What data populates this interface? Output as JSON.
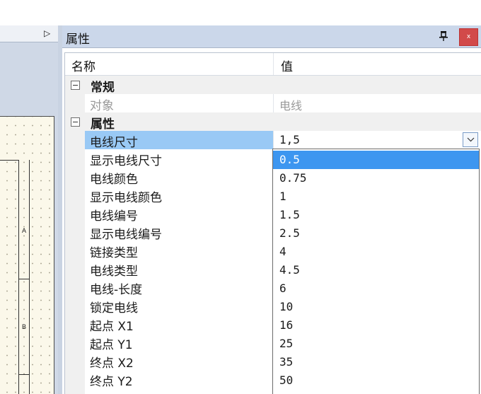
{
  "left_panel": {
    "collapse_arrow": "▷",
    "canvas_labels": [
      "A",
      "B"
    ]
  },
  "properties": {
    "title": "属性",
    "pin_icon": "pin-icon",
    "close_label": "x",
    "columns": {
      "name": "名称",
      "value": "值"
    },
    "rows": [
      {
        "kind": "category",
        "name": "常规"
      },
      {
        "kind": "property",
        "name": "对象",
        "value": "电线",
        "disabled": true
      },
      {
        "kind": "category",
        "name": "属性"
      },
      {
        "kind": "property",
        "name": "电线尺寸",
        "value": "1,5",
        "selected": true
      },
      {
        "kind": "property",
        "name": "显示电线尺寸"
      },
      {
        "kind": "property",
        "name": "电线颜色"
      },
      {
        "kind": "property",
        "name": "显示电线颜色"
      },
      {
        "kind": "property",
        "name": "电线编号"
      },
      {
        "kind": "property",
        "name": "显示电线编号"
      },
      {
        "kind": "property",
        "name": "链接类型"
      },
      {
        "kind": "property",
        "name": "电线类型"
      },
      {
        "kind": "property",
        "name": "电线-长度"
      },
      {
        "kind": "property",
        "name": "锁定电线"
      },
      {
        "kind": "property",
        "name": "起点 X1"
      },
      {
        "kind": "property",
        "name": "起点 Y1"
      },
      {
        "kind": "property",
        "name": "终点 X2"
      },
      {
        "kind": "property",
        "name": "终点 Y2"
      }
    ]
  },
  "dropdown": {
    "options": [
      "0.5",
      "0.75",
      "1",
      "1.5",
      "2.5",
      "4",
      "4.5",
      "6",
      "10",
      "16",
      "25",
      "35",
      "50"
    ],
    "highlighted": "0.5"
  },
  "colors": {
    "highlight": "#3d96f0",
    "selected_name": "#99c9f5",
    "close": "#d24a4a"
  }
}
